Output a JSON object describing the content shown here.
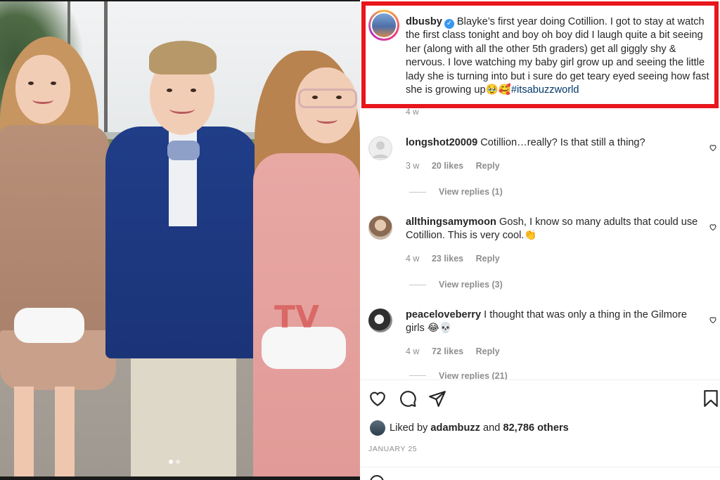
{
  "post": {
    "username": "dbusby",
    "caption_text": "Blayke’s first year doing Cotillion. I got to stay at watch the first class tonight and boy oh boy did I laugh quite a bit seeing her (along with all the other 5th graders) get all giggly shy & nervous. I love watching my baby girl grow up and seeing the little lady she is turning into but i sure do get teary eyed seeing how fast she is growing up🥹🥰",
    "hashtag": "#itsabuzzworld",
    "time": "4 w"
  },
  "comments": [
    {
      "username": "longshot20009",
      "text": "Cotillion…really? Is that still a thing?",
      "time": "3 w",
      "likes": "20 likes",
      "reply": "Reply",
      "view_replies": "View replies (1)"
    },
    {
      "username": "allthingsamymoon",
      "text": "Gosh, I know so many adults that could use Cotillion. This is very cool.👏",
      "time": "4 w",
      "likes": "23 likes",
      "reply": "Reply",
      "view_replies": "View replies (3)"
    },
    {
      "username": "peaceloveberry",
      "text": "I thought that was only a thing in the Gilmore girls 😂💀",
      "time": "4 w",
      "likes": "72 likes",
      "reply": "Reply",
      "view_replies": "View replies (21)"
    }
  ],
  "likes_line": {
    "prefix": "Liked by",
    "user": "adambuzz",
    "middle": "and",
    "count": "82,786 others"
  },
  "date": "JANUARY 25",
  "watermark": "TV",
  "icons": {
    "like": "heart-icon",
    "comment": "comment-icon",
    "share": "send-icon",
    "save": "bookmark-icon",
    "verified": "verified-badge-icon"
  },
  "colors": {
    "highlight_border": "#e8161c",
    "verified": "#3897f0",
    "hashtag": "#00376b",
    "meta_gray": "#8e8e8e"
  }
}
